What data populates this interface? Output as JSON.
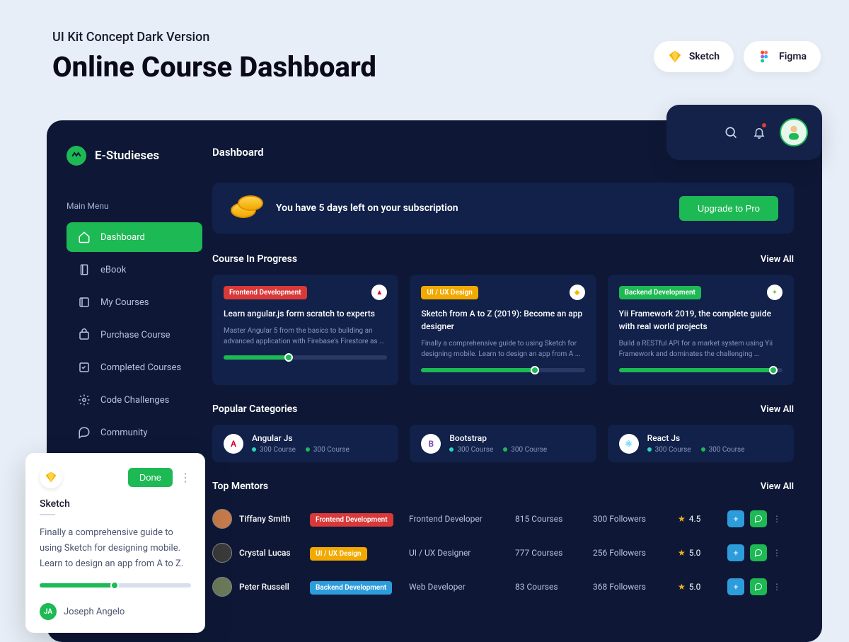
{
  "header": {
    "subtitle": "UI Kit Concept Dark Version",
    "title": "Online Course Dashboard"
  },
  "tools": {
    "sketch": "Sketch",
    "figma": "Figma"
  },
  "brand": {
    "name": "E-Studieses"
  },
  "sidebar": {
    "heading": "Main Menu",
    "items": [
      {
        "label": "Dashboard"
      },
      {
        "label": "eBook"
      },
      {
        "label": "My Courses"
      },
      {
        "label": "Purchase Course"
      },
      {
        "label": "Completed Courses"
      },
      {
        "label": "Code Challenges"
      },
      {
        "label": "Community"
      }
    ]
  },
  "dashboard": {
    "title": "Dashboard",
    "banner": {
      "text": "You have 5 days left on your subscription",
      "cta": "Upgrade to Pro"
    },
    "courses": {
      "heading": "Course In Progress",
      "view_all": "View All",
      "items": [
        {
          "tag": "Frontend Development",
          "title": "Learn angular.js form scratch to experts",
          "desc": "Master Angular 5 from the basics to building an advanced application with Firebase's Firestore as ..."
        },
        {
          "tag": "UI / UX Design",
          "title": "Sketch from A to Z (2019): Become an app designer",
          "desc": "Finally a comprehensive guide to using Sketch for designing mobile. Learn to design an app from A ..."
        },
        {
          "tag": "Backend Development",
          "title": "Yii Framework 2019, the complete guide with real world projects",
          "desc": "Build a RESTful API for a market system using Yii Framework and dominates the challenging ..."
        }
      ]
    },
    "categories": {
      "heading": "Popular Categories",
      "view_all": "View All",
      "items": [
        {
          "name": "Angular Js",
          "stat1": "300 Course",
          "stat2": "300 Course"
        },
        {
          "name": "Bootstrap",
          "stat1": "300 Course",
          "stat2": "300 Course"
        },
        {
          "name": "React Js",
          "stat1": "300 Course",
          "stat2": "300 Course"
        }
      ]
    },
    "mentors": {
      "heading": "Top Mentors",
      "view_all": "View All",
      "rows": [
        {
          "name": "Tiffany Smith",
          "tag": "Frontend Development",
          "role": "Frontend Developer",
          "courses": "815 Courses",
          "followers": "300 Followers",
          "rating": "4.5"
        },
        {
          "name": "Crystal Lucas",
          "tag": "UI / UX Design",
          "role": "UI / UX Designer",
          "courses": "777 Courses",
          "followers": "256 Followers",
          "rating": "5.0"
        },
        {
          "name": "Peter Russell",
          "tag": "Backend Development",
          "role": "Web Developer",
          "courses": "83  Courses",
          "followers": "368 Followers",
          "rating": "5.0"
        }
      ]
    }
  },
  "popover": {
    "done": "Done",
    "name": "Sketch",
    "desc": "Finally a comprehensive guide to using Sketch for designing mobile. Learn to design an app from A to Z.",
    "user_initials": "JA",
    "user_name": "Joseph Angelo"
  }
}
